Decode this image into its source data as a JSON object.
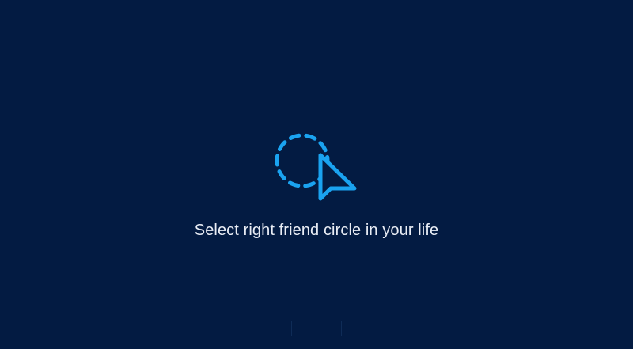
{
  "screen": {
    "tagline": "Select right friend circle in your life"
  },
  "icon": {
    "name": "dashed-circle-cursor-icon",
    "color": "#1aa3f0"
  },
  "colors": {
    "background": "#031b42",
    "text": "#e9edf5",
    "accent": "#1aa3f0"
  }
}
